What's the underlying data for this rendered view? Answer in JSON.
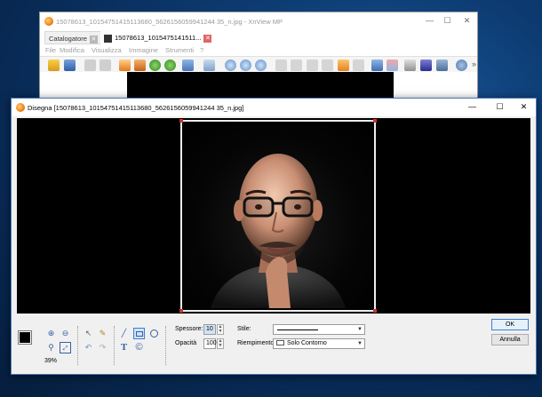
{
  "bg_window": {
    "title": "15078613_10154751415113680_5626156059941244 35_n.jpg - XnView MP",
    "tabs": [
      {
        "label": "Catalogatore",
        "active": false
      },
      {
        "label": "15078613_1015475141511...",
        "active": true
      }
    ],
    "menu": [
      "File",
      "Modifica",
      "Visualizza",
      "Immagine",
      "Strumenti",
      "?"
    ],
    "toolbar_icons": [
      "browse-icon",
      "save-icon",
      "open-icon",
      "open2-icon",
      "crop-icon",
      "resize-icon",
      "rotate-left-icon",
      "rotate-right-icon",
      "adjust-icon",
      "flag-icon",
      "zoom-in-icon",
      "zoom-fit-icon",
      "zoom-out-icon",
      "prev-icon",
      "next-icon",
      "first-icon",
      "last-icon",
      "slideshow-icon",
      "compare-icon",
      "fullscreen-icon",
      "paint-icon",
      "print-icon",
      "settings-icon",
      "save-as-icon",
      "gear-icon"
    ],
    "overflow": "»"
  },
  "draw_window": {
    "title": "Disegna [15078613_10154751415113680_5626156059941244 35_n.jpg]",
    "zoom": "39%",
    "thickness_label": "Spessore:",
    "thickness_value": "10",
    "opacity_label": "Opacità",
    "opacity_value": "100",
    "style_label": "Stile:",
    "fill_label": "Riempimento:",
    "fill_value": "Solo Contorno",
    "ok_label": "OK",
    "cancel_label": "Annulla"
  },
  "colors": {
    "accent_blue": "#3c7fd4",
    "selection_handle": "#cc3333"
  }
}
